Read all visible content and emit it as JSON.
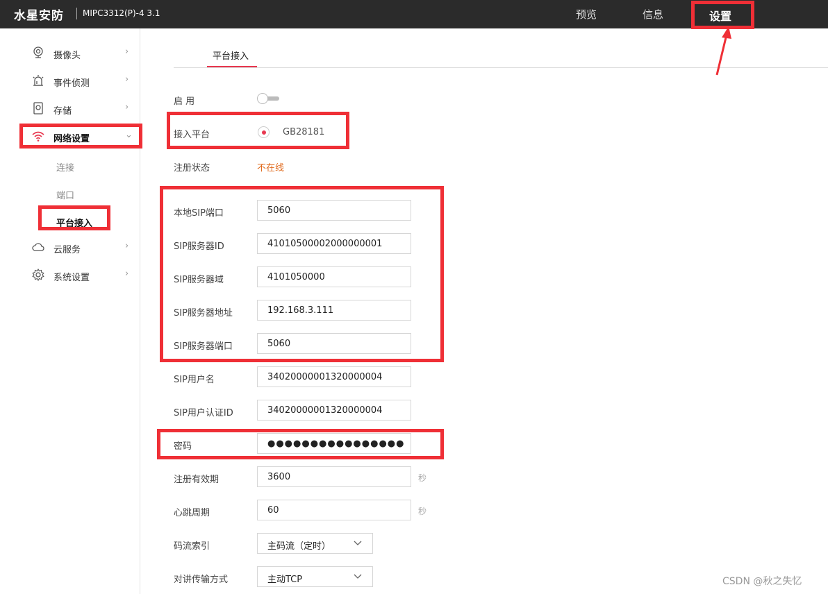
{
  "header": {
    "brand": "水星安防",
    "model": "MIPC3312(P)-4 3.1",
    "nav": [
      "预览",
      "信息",
      "设置"
    ],
    "active_nav": "设置"
  },
  "sidebar": {
    "items": [
      {
        "label": "摄像头",
        "icon": "camera-icon",
        "arrow": "›"
      },
      {
        "label": "事件侦测",
        "icon": "alarm-icon",
        "arrow": "›"
      },
      {
        "label": "存储",
        "icon": "storage-icon",
        "arrow": "›"
      },
      {
        "label": "网络设置",
        "icon": "wifi-icon",
        "arrow": "⌄"
      },
      {
        "label": "云服务",
        "icon": "cloud-icon",
        "arrow": "›"
      },
      {
        "label": "系统设置",
        "icon": "gear-icon",
        "arrow": "›"
      }
    ],
    "subitems": [
      "连接",
      "端口",
      "平台接入"
    ],
    "active_item": "网络设置",
    "active_subitem": "平台接入"
  },
  "tab": {
    "label": "平台接入"
  },
  "form": {
    "enable_label": "启 用",
    "enabled": false,
    "platform_label": "接入平台",
    "platform_value": "GB28181",
    "reg_status_label": "注册状态",
    "reg_status_value": "不在线",
    "fields": [
      {
        "label": "本地SIP端口",
        "value": "5060"
      },
      {
        "label": "SIP服务器ID",
        "value": "41010500002000000001"
      },
      {
        "label": "SIP服务器域",
        "value": "4101050000"
      },
      {
        "label": "SIP服务器地址",
        "value": "192.168.3.111"
      },
      {
        "label": "SIP服务器端口",
        "value": "5060"
      },
      {
        "label": "SIP用户名",
        "value": "34020000001320000004"
      },
      {
        "label": "SIP用户认证ID",
        "value": "34020000001320000004"
      },
      {
        "label": "密码",
        "value": "●●●●●●●●●●●●●●●●"
      },
      {
        "label": "注册有效期",
        "value": "3600",
        "unit": "秒"
      },
      {
        "label": "心跳周期",
        "value": "60",
        "unit": "秒"
      }
    ],
    "selects": [
      {
        "label": "码流索引",
        "value": "主码流（定时）"
      },
      {
        "label": "对讲传输方式",
        "value": "主动TCP"
      }
    ]
  },
  "watermark": "CSDN @秋之失忆",
  "colors": {
    "accent": "#e8374f",
    "highlight": "#ef2f36",
    "status_offline": "#e06a1d",
    "topbar": "#2b2b2b"
  }
}
